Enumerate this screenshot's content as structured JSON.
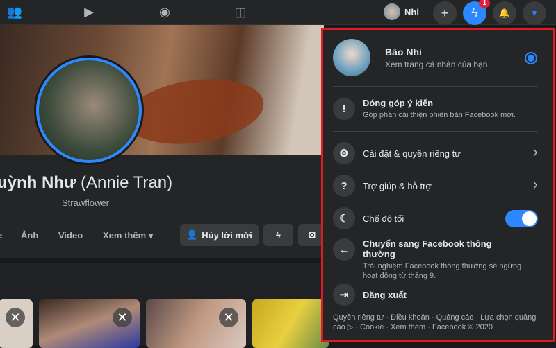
{
  "topbar": {
    "user_name": "Nhi",
    "notification_count": "1"
  },
  "profile": {
    "name_main": "uỳnh Như",
    "name_alt": "(Annie Tran)",
    "subtitle": "Strawflower"
  },
  "tabs": [
    "e",
    "Ảnh",
    "Video",
    "Xem thêm ▾"
  ],
  "actions": {
    "cancel_request": "Hủy lời mời"
  },
  "menu": {
    "user_name": "Bão Nhi",
    "user_sub": "Xem trang cá nhân của bạn",
    "feedback_title": "Đóng góp ý kiến",
    "feedback_sub": "Góp phần cải thiện phiên bản Facebook mới.",
    "settings": "Cài đặt & quyền riêng tư",
    "help": "Trợ giúp & hỗ trợ",
    "dark_mode": "Chế độ tối",
    "dark_mode_on": true,
    "classic_title": "Chuyển sang Facebook thông thường",
    "classic_sub": "Trải nghiệm Facebook thông thường sẽ ngừng hoạt động từ tháng 9.",
    "logout": "Đăng xuất",
    "footer": "Quyền riêng tư · Điều khoản · Quảng cáo · Lựa chọn quảng cáo ▷ · Cookie · Xem thêm · Facebook © 2020"
  },
  "colors": {
    "accent": "#2d88ff",
    "highlight_border": "#e01b24",
    "badge": "#e41e3f"
  }
}
